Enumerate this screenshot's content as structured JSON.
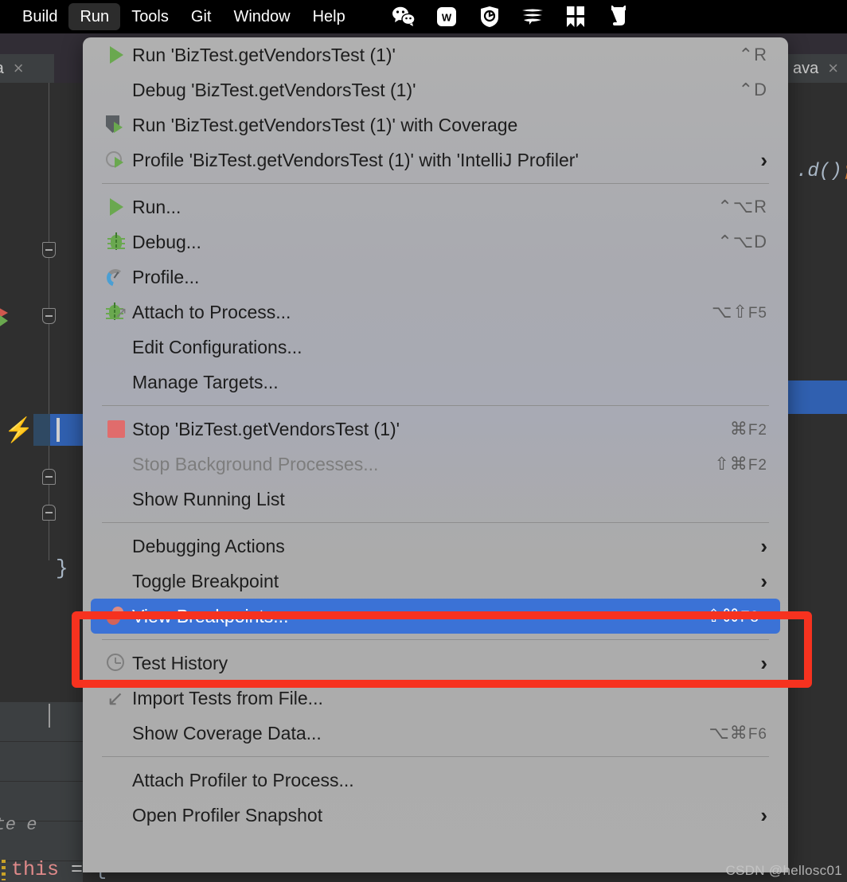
{
  "mac_menu_bar": {
    "menus": [
      {
        "label": "Build",
        "active": false
      },
      {
        "label": "Run",
        "active": true
      },
      {
        "label": "Tools",
        "active": false
      },
      {
        "label": "Git",
        "active": false
      },
      {
        "label": "Window",
        "active": false
      },
      {
        "label": "Help",
        "active": false
      }
    ],
    "tray_icons": [
      {
        "name": "wechat-icon"
      },
      {
        "name": "wps-office-icon"
      },
      {
        "name": "security-shield-icon"
      },
      {
        "name": "tencent-lemon-icon"
      },
      {
        "name": "four-square-icon"
      },
      {
        "name": "cat-icon"
      }
    ]
  },
  "editor": {
    "tab_left_label": "java",
    "tab_left_close": "×",
    "tab_right_label": "ava",
    "tab_right_close": "×",
    "code_right": ".d()",
    "code_right_semi": ";",
    "closing_brace": "}",
    "debugger_hint": "luate e",
    "debugger_this": "this",
    "debugger_eq": " = ",
    "debugger_brace": "{"
  },
  "run_menu": {
    "groups": [
      {
        "items": [
          {
            "label": "Run 'BizTest.getVendorsTest (1)'",
            "icon": "play-icon",
            "shortcut": "⌃R",
            "submenu": false,
            "disabled": false,
            "selected": false
          },
          {
            "label": "Debug 'BizTest.getVendorsTest (1)'",
            "icon": "none",
            "shortcut": "⌃D",
            "submenu": false,
            "disabled": false,
            "selected": false
          },
          {
            "label": "Run 'BizTest.getVendorsTest (1)' with Coverage",
            "icon": "coverage-icon",
            "shortcut": "",
            "submenu": false,
            "disabled": false,
            "selected": false
          },
          {
            "label": "Profile 'BizTest.getVendorsTest (1)' with 'IntelliJ Profiler'",
            "icon": "profile-run-icon",
            "shortcut": "",
            "submenu": true,
            "disabled": false,
            "selected": false
          }
        ]
      },
      {
        "items": [
          {
            "label": "Run...",
            "icon": "play-icon",
            "shortcut": "⌃⌥R",
            "submenu": false,
            "disabled": false,
            "selected": false
          },
          {
            "label": "Debug...",
            "icon": "bug-icon",
            "shortcut": "⌃⌥D",
            "submenu": false,
            "disabled": false,
            "selected": false
          },
          {
            "label": "Profile...",
            "icon": "meter-icon",
            "shortcut": "",
            "submenu": false,
            "disabled": false,
            "selected": false
          },
          {
            "label": "Attach to Process...",
            "icon": "attach-icon",
            "shortcut": "⌥⇧F5",
            "submenu": false,
            "disabled": false,
            "selected": false
          },
          {
            "label": "Edit Configurations...",
            "icon": "none",
            "shortcut": "",
            "submenu": false,
            "disabled": false,
            "selected": false
          },
          {
            "label": "Manage Targets...",
            "icon": "none",
            "shortcut": "",
            "submenu": false,
            "disabled": false,
            "selected": false
          }
        ]
      },
      {
        "items": [
          {
            "label": "Stop 'BizTest.getVendorsTest (1)'",
            "icon": "stop-icon",
            "shortcut": "⌘F2",
            "submenu": false,
            "disabled": false,
            "selected": false
          },
          {
            "label": "Stop Background Processes...",
            "icon": "none",
            "shortcut": "⇧⌘F2",
            "submenu": false,
            "disabled": true,
            "selected": false
          },
          {
            "label": "Show Running List",
            "icon": "none",
            "shortcut": "",
            "submenu": false,
            "disabled": false,
            "selected": false
          }
        ]
      },
      {
        "items": [
          {
            "label": "Debugging Actions",
            "icon": "none",
            "shortcut": "",
            "submenu": true,
            "disabled": false,
            "selected": false
          },
          {
            "label": "Toggle Breakpoint",
            "icon": "none",
            "shortcut": "",
            "submenu": true,
            "disabled": false,
            "selected": false
          },
          {
            "label": "View Breakpoints...",
            "icon": "breakpoint-icon",
            "shortcut": "⇧⌘F8",
            "submenu": false,
            "disabled": false,
            "selected": true
          }
        ]
      },
      {
        "items": [
          {
            "label": "Test History",
            "icon": "clock-icon",
            "shortcut": "",
            "submenu": true,
            "disabled": false,
            "selected": false
          },
          {
            "label": "Import Tests from File...",
            "icon": "import-icon",
            "shortcut": "",
            "submenu": false,
            "disabled": false,
            "selected": false
          },
          {
            "label": "Show Coverage Data...",
            "icon": "none",
            "shortcut": "⌥⌘F6",
            "submenu": false,
            "disabled": false,
            "selected": false
          }
        ]
      },
      {
        "items": [
          {
            "label": "Attach Profiler to Process...",
            "icon": "none",
            "shortcut": "",
            "submenu": false,
            "disabled": false,
            "selected": false
          },
          {
            "label": "Open Profiler Snapshot",
            "icon": "none",
            "shortcut": "",
            "submenu": true,
            "disabled": false,
            "selected": false
          }
        ]
      }
    ]
  },
  "annotation": {
    "color": "#f6321f"
  },
  "watermark": {
    "text": "CSDN @hellosc01"
  }
}
